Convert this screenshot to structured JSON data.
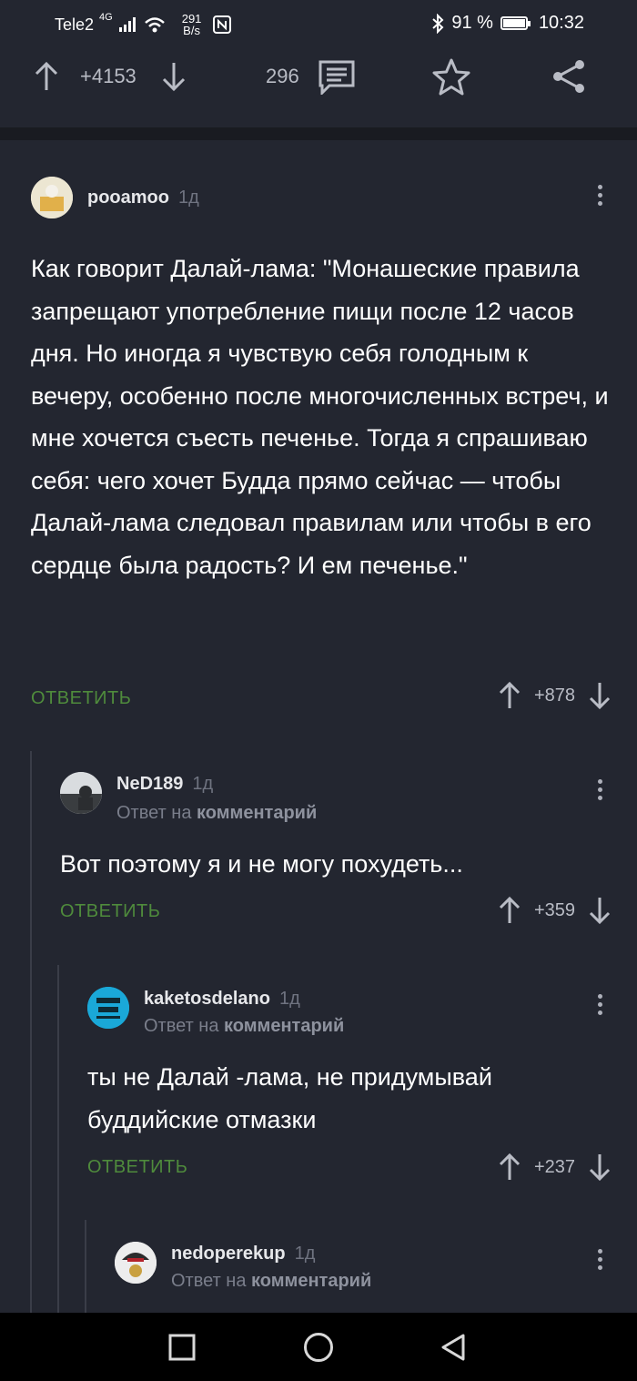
{
  "status_bar": {
    "carrier": "Tele2",
    "network_type": "4G",
    "net_speed_value": "291",
    "net_speed_unit": "B/s",
    "battery_percent": "91 %",
    "battery_level": 0.91,
    "time": "10:32"
  },
  "story_actions": {
    "rating": "+4153",
    "comments_count": "296"
  },
  "comments": [
    {
      "author": "pooamoo",
      "time": "1д",
      "reply_to_prefix": "",
      "reply_to_target": "",
      "text": "Как говорит Далай-лама: \"Монашеские правила запрещают употребление пищи после 12 часов дня. Но иногда я чувствую себя голодным к вечеру, особенно после многочисленных встреч, и мне хочется съесть печенье. Тогда я спрашиваю себя: чего хочет Будда прямо сейчас — чтобы Далай-лама следовал правилам или чтобы в его сердце была радость? И ем печенье.\"",
      "reply_label": "ОТВЕТИТЬ",
      "rating": "+878"
    },
    {
      "author": "NeD189",
      "time": "1д",
      "reply_to_prefix": "Ответ на",
      "reply_to_target": "комментарий",
      "text": "Вот поэтому я и не могу похудеть...",
      "reply_label": "ОТВЕТИТЬ",
      "rating": "+359"
    },
    {
      "author": "kaketosdelano",
      "time": "1д",
      "reply_to_prefix": "Ответ на",
      "reply_to_target": "комментарий",
      "text": "ты не Далай -лама, не придумывай буддийские отмазки",
      "reply_label": "ОТВЕТИТЬ",
      "rating": "+237"
    },
    {
      "author": "nedoperekup",
      "time": "1д",
      "reply_to_prefix": "Ответ на",
      "reply_to_target": "комментарий"
    }
  ],
  "colors": {
    "background": "#232630",
    "accent_reply": "#4f8b3c",
    "muted": "#7a7e8b"
  }
}
